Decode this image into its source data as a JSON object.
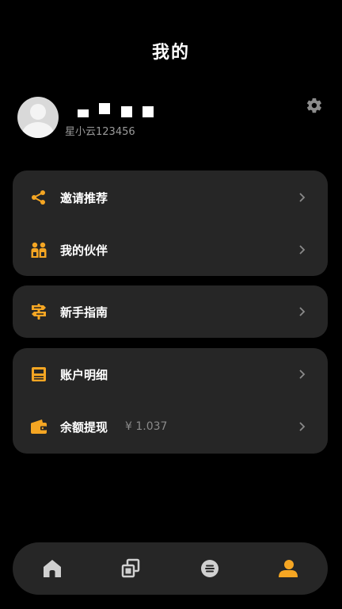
{
  "header": {
    "title": "我的"
  },
  "profile": {
    "user_id": "星小云123456"
  },
  "menu_groups": [
    {
      "items": [
        {
          "label": "邀请推荐",
          "icon": "share-icon"
        },
        {
          "label": "我的伙伴",
          "icon": "partners-icon"
        }
      ]
    },
    {
      "items": [
        {
          "label": "新手指南",
          "icon": "signpost-icon"
        }
      ]
    },
    {
      "items": [
        {
          "label": "账户明细",
          "icon": "ledger-icon"
        },
        {
          "label": "余额提现",
          "icon": "wallet-icon",
          "value": "¥ 1.037"
        }
      ]
    }
  ],
  "tabbar": {
    "tabs": [
      {
        "icon": "home-icon",
        "active": false
      },
      {
        "icon": "cards-icon",
        "active": false
      },
      {
        "icon": "list-circle-icon",
        "active": false
      },
      {
        "icon": "profile-icon",
        "active": true
      }
    ]
  },
  "colors": {
    "background": "#000000",
    "card": "#262626",
    "accent": "#f5a623",
    "icon_inactive": "#d0d0d0",
    "text_secondary": "#9a9a9a"
  }
}
